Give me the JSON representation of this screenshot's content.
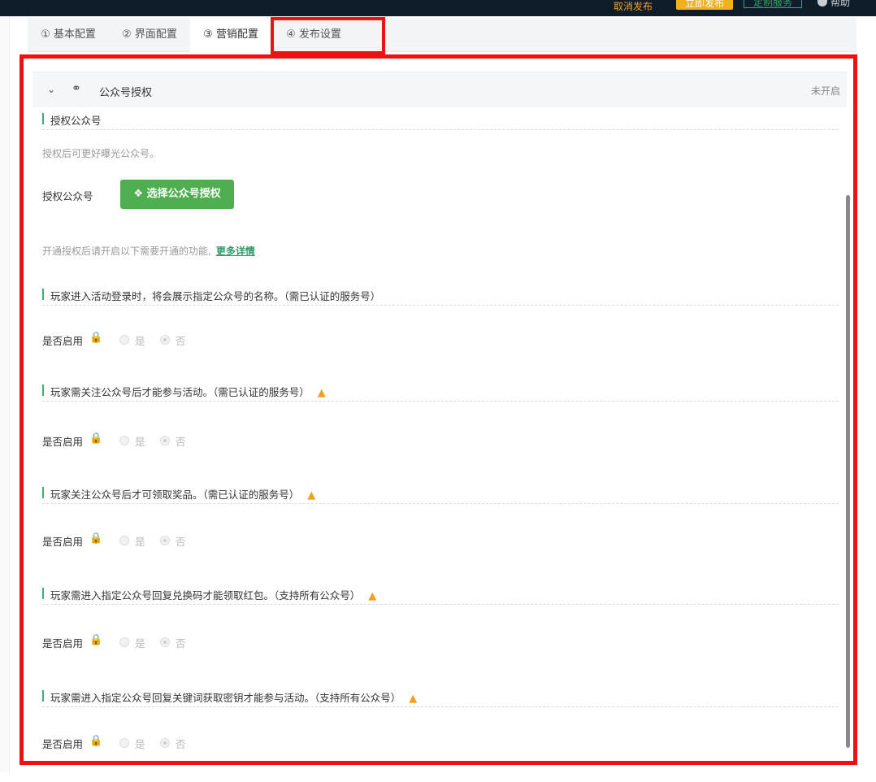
{
  "topbar": {
    "unpublish": "取消发布",
    "publish": "立即发布",
    "custom_service": "定制服务",
    "help": "帮助"
  },
  "tabs": [
    {
      "label": "① 基本配置"
    },
    {
      "label": "② 界面配置"
    },
    {
      "label": "③ 营销配置"
    },
    {
      "label": "④ 发布设置"
    }
  ],
  "section": {
    "title": "公众号授权",
    "status": "未开启",
    "auth_heading": "授权公众号",
    "auth_desc": "授权后可更好曝光公众号。",
    "auth_label": "授权公众号",
    "auth_button": "选择公众号授权",
    "more_note": "开通授权后请开启以下需要开通的功能,",
    "more_link": "更多详情"
  },
  "features": [
    {
      "title": "玩家进入活动登录时，将会展示指定公众号的名称。（需已认证的服务号）",
      "warn": false
    },
    {
      "title": "玩家需关注公众号后才能参与活动。（需已认证的服务号）",
      "warn": true
    },
    {
      "title": "玩家关注公众号后才可领取奖品。（需已认证的服务号）",
      "warn": true
    },
    {
      "title": "玩家需进入指定公众号回复兑换码才能领取红包。（支持所有公众号）",
      "warn": true
    },
    {
      "title": "玩家需进入指定公众号回复关键词获取密钥才能参与活动。（支持所有公众号）",
      "warn": true
    }
  ],
  "option": {
    "label": "是否启用",
    "yes": "是",
    "no": "否"
  },
  "colors": {
    "accent_green": "#4fae4f",
    "link_green": "#2f9a68",
    "highlight_red": "#ee1111",
    "warn": "#f0a020"
  }
}
